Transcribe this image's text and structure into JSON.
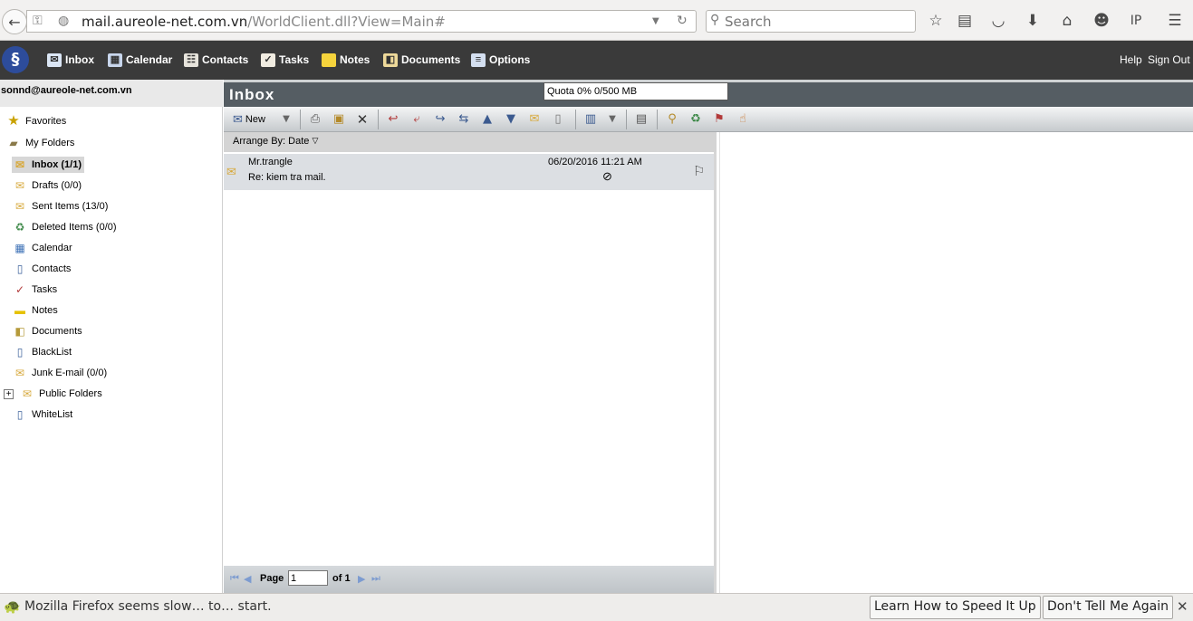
{
  "browser": {
    "url_host": "mail.aureole-net.com.vn",
    "url_path": "/WorldClient.dll?View=Main#",
    "search_placeholder": "Search"
  },
  "nav": {
    "items": [
      {
        "label": "Inbox",
        "icon": "envelope-icon"
      },
      {
        "label": "Calendar",
        "icon": "calendar-icon"
      },
      {
        "label": "Contacts",
        "icon": "contacts-icon"
      },
      {
        "label": "Tasks",
        "icon": "tasks-icon"
      },
      {
        "label": "Notes",
        "icon": "notes-icon"
      },
      {
        "label": "Documents",
        "icon": "documents-icon"
      },
      {
        "label": "Options",
        "icon": "options-icon"
      }
    ],
    "help": "Help",
    "sign_out": "Sign Out"
  },
  "sidebar": {
    "account": "sonnd@aureole-net.com.vn",
    "favorites": "Favorites",
    "my_folders": "My Folders",
    "folders": [
      "Inbox (1/1)",
      "Drafts (0/0)",
      "Sent Items (13/0)",
      "Deleted Items (0/0)",
      "Calendar",
      "Contacts",
      "Tasks",
      "Notes",
      "Documents",
      "BlackList",
      "Junk E-mail (0/0)",
      "Public Folders",
      "WhiteList"
    ]
  },
  "main": {
    "title": "Inbox",
    "quota": "Quota 0% 0/500 MB",
    "new_label": "New",
    "arrange_label": "Arrange By:",
    "arrange_value": "Date"
  },
  "messages": [
    {
      "from": "Mr.trangle",
      "subject": "Re: kiem tra mail.",
      "date": "06/20/2016 11:21 AM"
    }
  ],
  "pager": {
    "page_label": "Page",
    "page_value": "1",
    "of_label": "of 1"
  },
  "notification": {
    "message": "Mozilla Firefox seems slow… to… start.",
    "learn_button": "Learn How to Speed It Up",
    "dismiss_button": "Don't Tell Me Again"
  }
}
